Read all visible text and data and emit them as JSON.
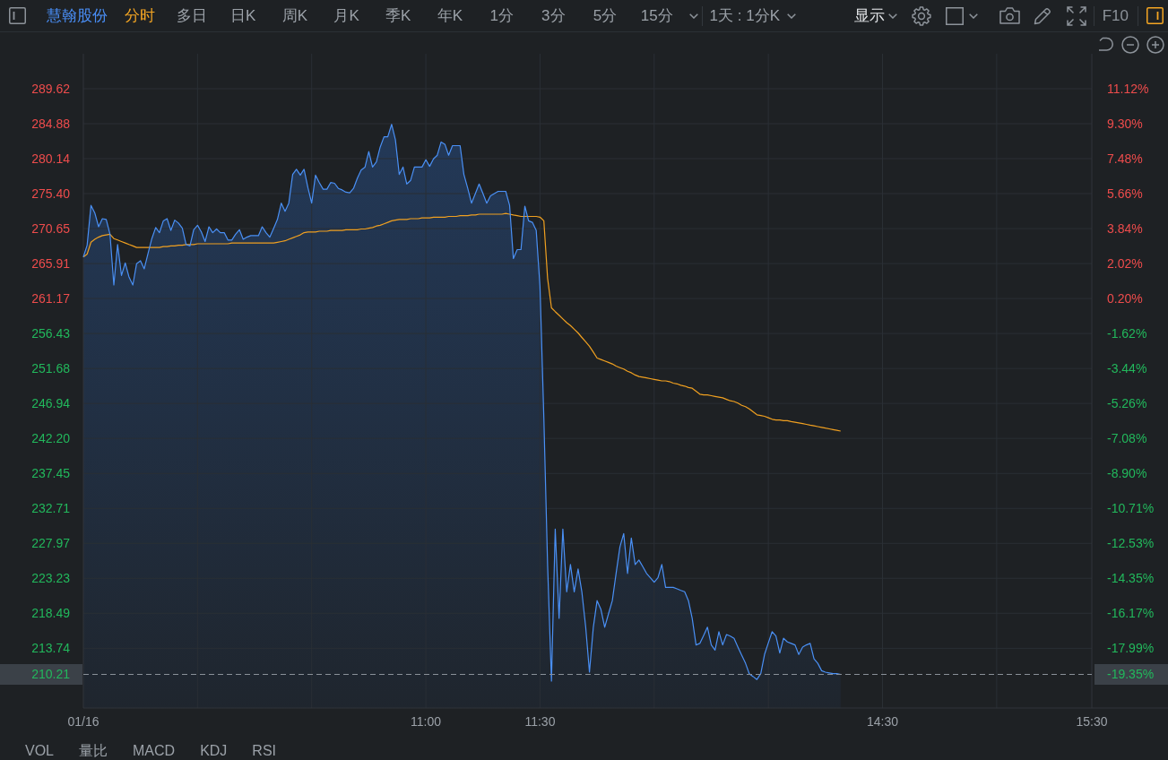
{
  "toolbar": {
    "left_panel_toggle": {
      "on": false
    },
    "stock_name": "慧翰股份",
    "period_tabs": [
      {
        "label": "分时",
        "selected": true
      },
      {
        "label": "多日",
        "selected": false
      },
      {
        "label": "日K",
        "selected": false
      },
      {
        "label": "周K",
        "selected": false
      },
      {
        "label": "月K",
        "selected": false
      },
      {
        "label": "季K",
        "selected": false
      },
      {
        "label": "年K",
        "selected": false
      },
      {
        "label": "1分",
        "selected": false
      },
      {
        "label": "3分",
        "selected": false
      },
      {
        "label": "5分",
        "selected": false
      },
      {
        "label": "15分",
        "selected": false
      }
    ],
    "range_select": {
      "value": "1天 : 1分K"
    },
    "display_menu": {
      "label": "显示"
    },
    "f10_button": {
      "label": "F10"
    },
    "right_panel_toggle": {
      "on": true
    }
  },
  "chart": {
    "chart_data": {
      "type": "line",
      "grid": true,
      "categories": [
        "01/16",
        null,
        null,
        null,
        null,
        null,
        null,
        null,
        null,
        null,
        null,
        null,
        null,
        null,
        null,
        null,
        null,
        null,
        null,
        null,
        null,
        null,
        null,
        null,
        null,
        null,
        null,
        null,
        null,
        null,
        null,
        null,
        null,
        null,
        null,
        null,
        null,
        null,
        null,
        null,
        null,
        null,
        null,
        null,
        null,
        null,
        null,
        null,
        null,
        null,
        null,
        null,
        null,
        null,
        null,
        null,
        null,
        null,
        null,
        null,
        null,
        null,
        null,
        null,
        null,
        null,
        null,
        null,
        null,
        null,
        null,
        null,
        null,
        null,
        null,
        null,
        null,
        null,
        null,
        null,
        null,
        null,
        null,
        null,
        null,
        null,
        null,
        null,
        null,
        null,
        "11:00",
        null,
        null,
        null,
        null,
        null,
        null,
        null,
        null,
        null,
        null,
        null,
        null,
        null,
        null,
        null,
        null,
        null,
        null,
        null,
        null,
        null,
        null,
        null,
        null,
        null,
        null,
        null,
        null,
        null,
        "11:30",
        null,
        null,
        null,
        null,
        null,
        null,
        null,
        null,
        null,
        null,
        null,
        null,
        null,
        null,
        null,
        null,
        null,
        null,
        null,
        null,
        null,
        null,
        null,
        null,
        null,
        null,
        null,
        null,
        null,
        null,
        null,
        null,
        null,
        null,
        null,
        null,
        null,
        null,
        null,
        null,
        null,
        null,
        null,
        null,
        null,
        null,
        null,
        null,
        null,
        null,
        null,
        null,
        null,
        null,
        null,
        null,
        null,
        null,
        null,
        null,
        null,
        null,
        null,
        null,
        null,
        null,
        null,
        null,
        null,
        null,
        null,
        null,
        null,
        null,
        null,
        null,
        null,
        null,
        null,
        null,
        null,
        null,
        null,
        null,
        null,
        null,
        null,
        null,
        null,
        "14:30",
        null,
        null,
        null,
        null,
        null,
        null,
        null,
        null,
        null,
        null,
        null,
        null,
        null,
        null,
        null,
        null,
        null,
        null,
        null,
        null,
        null,
        null,
        null,
        null,
        null,
        null,
        null,
        null,
        null,
        null,
        null,
        null,
        null,
        null,
        null,
        null,
        null,
        null,
        null,
        null,
        null,
        null,
        null,
        null,
        null,
        null,
        null,
        null,
        null,
        null,
        null,
        null,
        null,
        null,
        "15:30"
      ],
      "series": [
        {
          "color": "#4a90f5",
          "values": [
            266.8,
            268.4,
            273.8,
            272.8,
            270.9,
            272.0,
            271.9,
            269.9,
            263.0,
            268.5,
            264.3,
            266.0,
            264.1,
            263.0,
            265.9,
            266.3,
            265.2,
            267.3,
            269.3,
            270.8,
            270.1,
            271.7,
            272.0,
            270.4,
            271.8,
            271.4,
            270.7,
            268.5,
            268.3,
            270.5,
            271.1,
            270.2,
            268.9,
            270.9,
            270.1,
            270.6,
            270.1,
            270.1,
            269.1,
            269.1,
            269.9,
            270.5,
            269.2,
            269.5,
            269.7,
            269.7,
            269.7,
            270.9,
            270.1,
            269.5,
            270.7,
            271.9,
            274.1,
            273.0,
            274.1,
            278.0,
            278.7,
            277.9,
            278.7,
            276.2,
            274.1,
            277.9,
            276.9,
            276.0,
            276.0,
            276.9,
            276.8,
            276.1,
            275.9,
            275.6,
            275.5,
            276.1,
            277.5,
            278.6,
            279.0,
            281.1,
            279.0,
            279.7,
            281.7,
            283.1,
            283.1,
            284.8,
            282.7,
            278.0,
            279.0,
            276.7,
            277.2,
            279.0,
            279.0,
            279.0,
            280.0,
            279.1,
            280.1,
            280.6,
            282.4,
            282.1,
            280.6,
            281.9,
            281.9,
            281.9,
            278.0,
            276.1,
            274.1,
            275.4,
            276.7,
            275.4,
            274.1,
            275.1,
            275.4,
            275.7,
            275.7,
            275.7,
            273.8,
            266.6,
            267.8,
            267.8,
            273.7,
            271.7,
            271.5,
            270.4,
            262.8,
            245.0,
            225.0,
            209.3,
            229.9,
            217.8,
            229.9,
            221.4,
            225.1,
            221.4,
            224.5,
            221.4,
            216.6,
            210.5,
            216.6,
            220.2,
            219.0,
            216.6,
            218.4,
            220.2,
            223.9,
            227.5,
            229.3,
            223.9,
            228.7,
            225.1,
            225.7,
            224.8,
            223.9,
            223.3,
            222.7,
            223.3,
            225.1,
            222.0,
            222.0,
            222.0,
            221.8,
            221.6,
            221.4,
            220.2,
            217.8,
            214.2,
            214.4,
            215.5,
            216.6,
            214.2,
            213.5,
            216.0,
            214.2,
            215.6,
            215.4,
            215.1,
            213.9,
            212.8,
            211.7,
            210.3,
            209.9,
            209.5,
            210.3,
            212.9,
            214.5,
            216.0,
            215.4,
            213.1,
            215.1,
            214.6,
            214.4,
            214.2,
            212.9,
            213.9,
            214.2,
            214.4,
            212.3,
            211.7,
            210.7,
            210.5,
            210.4,
            210.3,
            210.3,
            210.2,
            null,
            null,
            null,
            null,
            null,
            null,
            null,
            null,
            null,
            null,
            null,
            null,
            null,
            null,
            null,
            null,
            null,
            null,
            null,
            null,
            null,
            null,
            null,
            null,
            null,
            null,
            null,
            null,
            null,
            null,
            null,
            null,
            null,
            null,
            null,
            null,
            null,
            null,
            null,
            null,
            null,
            null,
            null,
            null,
            null,
            null,
            null,
            null,
            null,
            null,
            null,
            null,
            null,
            null,
            null,
            null,
            null,
            null,
            null,
            null,
            null,
            null,
            null,
            null,
            null,
            null
          ]
        },
        {
          "color": "#f0a020",
          "values": [
            266.8,
            267.2,
            268.8,
            269.2,
            269.5,
            269.7,
            269.8,
            269.9,
            269.3,
            269.1,
            268.9,
            268.7,
            268.5,
            268.3,
            268.1,
            268.1,
            268.1,
            268.1,
            268.1,
            268.1,
            268.1,
            268.2,
            268.2,
            268.3,
            268.3,
            268.4,
            268.4,
            268.5,
            268.5,
            268.5,
            268.6,
            268.6,
            268.6,
            268.6,
            268.6,
            268.6,
            268.6,
            268.6,
            268.6,
            268.7,
            268.7,
            268.7,
            268.7,
            268.7,
            268.7,
            268.7,
            268.7,
            268.7,
            268.7,
            268.7,
            268.7,
            268.8,
            268.9,
            269.0,
            269.2,
            269.4,
            269.6,
            269.8,
            270.1,
            270.2,
            270.2,
            270.2,
            270.3,
            270.3,
            270.3,
            270.4,
            270.4,
            270.4,
            270.4,
            270.5,
            270.5,
            270.5,
            270.5,
            270.6,
            270.6,
            270.7,
            270.8,
            271.0,
            271.1,
            271.3,
            271.5,
            271.7,
            271.8,
            271.9,
            271.9,
            271.9,
            272.0,
            272.0,
            272.0,
            272.1,
            272.1,
            272.1,
            272.2,
            272.2,
            272.2,
            272.2,
            272.3,
            272.3,
            272.3,
            272.4,
            272.4,
            272.4,
            272.5,
            272.5,
            272.6,
            272.6,
            272.6,
            272.6,
            272.6,
            272.6,
            272.6,
            272.7,
            272.6,
            272.5,
            272.4,
            272.3,
            272.3,
            272.3,
            272.3,
            272.3,
            272.2,
            271.7,
            263.9,
            259.9,
            259.4,
            258.9,
            258.4,
            257.9,
            257.5,
            257.0,
            256.5,
            255.9,
            255.3,
            254.7,
            253.9,
            253.1,
            252.9,
            252.7,
            252.5,
            252.3,
            252.0,
            251.8,
            251.6,
            251.3,
            251.1,
            250.8,
            250.6,
            250.5,
            250.4,
            250.3,
            250.2,
            250.1,
            250.0,
            250.0,
            249.9,
            249.7,
            249.6,
            249.4,
            249.3,
            249.1,
            249.0,
            248.6,
            248.2,
            248.1,
            248.1,
            248.0,
            247.9,
            247.8,
            247.7,
            247.5,
            247.3,
            247.2,
            247.0,
            246.7,
            246.5,
            246.2,
            245.8,
            245.4,
            245.3,
            245.2,
            245.0,
            244.8,
            244.7,
            244.7,
            244.6,
            244.6,
            244.5,
            244.4,
            244.3,
            244.2,
            244.1,
            244.0,
            243.9,
            243.8,
            243.7,
            243.6,
            243.5,
            243.4,
            243.3,
            243.2,
            null,
            null,
            null,
            null,
            null,
            null,
            null,
            null,
            null,
            null,
            null,
            null,
            null,
            null,
            null,
            null,
            null,
            null,
            null,
            null,
            null,
            null,
            null,
            null,
            null,
            null,
            null,
            null,
            null,
            null,
            null,
            null,
            null,
            null,
            null,
            null,
            null,
            null,
            null,
            null,
            null,
            null,
            null,
            null,
            null,
            null,
            null,
            null,
            null,
            null,
            null,
            null,
            null,
            null,
            null,
            null,
            null,
            null,
            null,
            null,
            null,
            null,
            null,
            null,
            null,
            null
          ]
        }
      ],
      "ylim": [
        205.64,
        294.36
      ],
      "yticks": [
        {
          "value": 289.62,
          "label": "289.62"
        },
        {
          "value": 284.88,
          "label": "284.88"
        },
        {
          "value": 280.14,
          "label": "280.14"
        },
        {
          "value": 275.4,
          "label": "275.40"
        },
        {
          "value": 270.65,
          "label": "270.65"
        },
        {
          "value": 265.91,
          "label": "265.91"
        },
        {
          "value": 261.17,
          "label": "261.17"
        },
        {
          "value": 256.43,
          "label": "256.43"
        },
        {
          "value": 251.68,
          "label": "251.68"
        },
        {
          "value": 246.94,
          "label": "246.94"
        },
        {
          "value": 242.2,
          "label": "242.20"
        },
        {
          "value": 237.45,
          "label": "237.45"
        },
        {
          "value": 232.71,
          "label": "232.71"
        },
        {
          "value": 227.97,
          "label": "227.97"
        },
        {
          "value": 223.23,
          "label": "223.23"
        },
        {
          "value": 218.49,
          "label": "218.49"
        },
        {
          "value": 213.74,
          "label": "213.74"
        }
      ],
      "ref_lines": [
        {
          "axis": "y",
          "value": 210.21,
          "label": "210.21"
        }
      ]
    },
    "axis_rows": [
      {
        "percent_label": "11.12%",
        "color": "#ee4c4c"
      },
      {
        "percent_label": "9.30%",
        "color": "#ee4c4c"
      },
      {
        "percent_label": "7.48%",
        "color": "#ee4c4c"
      },
      {
        "percent_label": "5.66%",
        "color": "#ee4c4c"
      },
      {
        "percent_label": "3.84%",
        "color": "#ee4c4c"
      },
      {
        "percent_label": "2.02%",
        "color": "#ee4c4c"
      },
      {
        "percent_label": "0.20%",
        "color": "#ee4c4c"
      },
      {
        "percent_label": "-1.62%",
        "color": "#22b85c"
      },
      {
        "percent_label": "-3.44%",
        "color": "#22b85c"
      },
      {
        "percent_label": "-5.26%",
        "color": "#22b85c"
      },
      {
        "percent_label": "-7.08%",
        "color": "#22b85c"
      },
      {
        "percent_label": "-8.90%",
        "color": "#22b85c"
      },
      {
        "percent_label": "-10.71%",
        "color": "#22b85c"
      },
      {
        "percent_label": "-12.53%",
        "color": "#22b85c"
      },
      {
        "percent_label": "-14.35%",
        "color": "#22b85c"
      },
      {
        "percent_label": "-16.17%",
        "color": "#22b85c"
      },
      {
        "percent_label": "-17.99%",
        "color": "#22b85c"
      }
    ],
    "change_tag": "-19.35%"
  },
  "indicator_tabs": [
    "VOL",
    "量比",
    "MACD",
    "KDJ",
    "RSI"
  ]
}
